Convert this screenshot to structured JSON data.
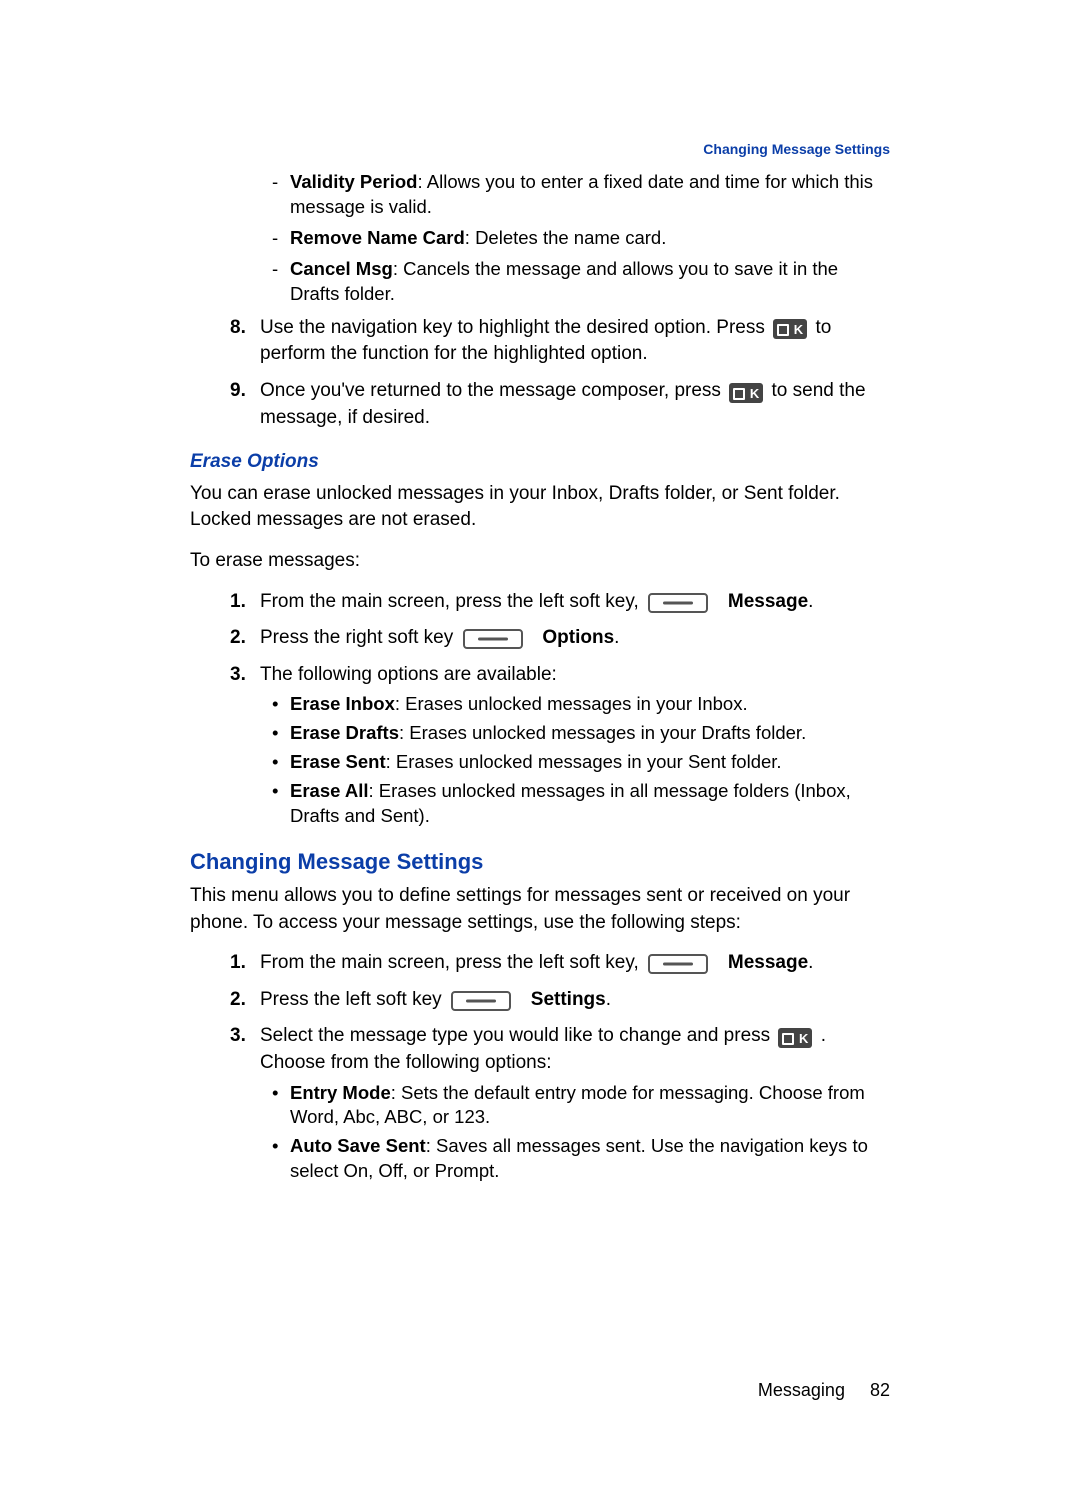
{
  "header": {
    "running_head": "Changing Message Settings"
  },
  "top_dashes": [
    {
      "term": "Validity Period",
      "desc": ": Allows you to enter a fixed date and time for which this message is valid."
    },
    {
      "term": "Remove Name Card",
      "desc": ": Deletes the name card."
    },
    {
      "term": "Cancel Msg",
      "desc": ": Cancels the message and allows you to save it in the Drafts folder."
    }
  ],
  "steps_top": {
    "s8_a": "Use the navigation key to highlight the desired option. Press ",
    "s8_b": " to perform the function for the highlighted option.",
    "s9_a": "Once you've returned to the message composer, press ",
    "s9_b": " to send the message, if desired."
  },
  "erase": {
    "heading": "Erase Options",
    "intro": "You can erase unlocked messages in your Inbox, Drafts folder, or Sent folder. Locked messages are not erased.",
    "lead": "To erase messages:",
    "s1_a": "From the main screen, press the left soft key, ",
    "s1_b": "Message",
    "s1_c": ".",
    "s2_a": "Press the right soft key ",
    "s2_b": "Options",
    "s2_c": ".",
    "s3": "The following options are available:",
    "bullets": [
      {
        "term": "Erase Inbox",
        "desc": ": Erases unlocked messages in your Inbox."
      },
      {
        "term": "Erase Drafts",
        "desc": ": Erases unlocked messages in your Drafts folder."
      },
      {
        "term": "Erase Sent",
        "desc": ": Erases unlocked messages in your Sent folder."
      },
      {
        "term": "Erase All",
        "desc": ": Erases unlocked messages in all message folders (Inbox, Drafts and Sent)."
      }
    ]
  },
  "changing": {
    "heading": "Changing Message Settings",
    "intro": "This menu allows you to define settings for messages sent or received on your phone. To access your message settings, use the following steps:",
    "s1_a": "From the main screen, press the left soft key, ",
    "s1_b": "Message",
    "s1_c": ".",
    "s2_a": "Press the left soft key ",
    "s2_b": "Settings",
    "s2_c": ".",
    "s3_a": "Select the message type you would like to change and press ",
    "s3_b": ". Choose from the following options:",
    "bullets": [
      {
        "term": "Entry Mode",
        "desc": ": Sets the default entry mode for messaging. Choose from Word, Abc, ABC, or 123."
      },
      {
        "term": "Auto Save Sent",
        "desc": ": Saves all messages sent. Use the navigation keys to select On, Off, or Prompt."
      }
    ]
  },
  "footer": {
    "chapter": "Messaging",
    "page": "82"
  }
}
